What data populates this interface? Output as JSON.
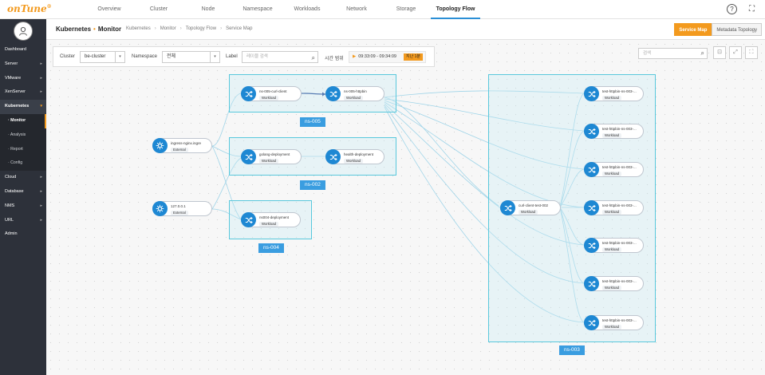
{
  "brand": {
    "name": "onTune",
    "mark": "®"
  },
  "nav": {
    "items": [
      "Overview",
      "Cluster",
      "Node",
      "Namespace",
      "Workloads",
      "Network",
      "Storage",
      "Topology Flow"
    ],
    "active": "Topology Flow"
  },
  "top_icons": [
    "help-icon",
    "fullscreen-icon"
  ],
  "sidebar": {
    "items": [
      {
        "label": "Dashboard"
      },
      {
        "label": "Server",
        "caret": "▸"
      },
      {
        "label": "VMware",
        "caret": "▸"
      },
      {
        "label": "XenServer",
        "caret": "▸"
      },
      {
        "label": "Kubernetes",
        "caret": "▾"
      }
    ],
    "sub_items": [
      "Monitor",
      "Analysis",
      "Report",
      "Config"
    ],
    "active_sub": "Monitor",
    "more_items": [
      {
        "label": "Cloud",
        "caret": "▸"
      },
      {
        "label": "Database",
        "caret": "▸"
      },
      {
        "label": "NMS",
        "caret": "▸"
      },
      {
        "label": "URL",
        "caret": "▸"
      },
      {
        "label": "Admin"
      }
    ]
  },
  "header": {
    "title_a": "Kubernetes",
    "title_b": "Monitor",
    "breadcrumb": [
      "Kubernetes",
      "Monitor",
      "Topology Flow",
      "Service Map"
    ],
    "view_buttons": [
      "Service Map",
      "Metadata Topology"
    ]
  },
  "filters": {
    "cluster_label": "Cluster",
    "cluster_value": "be-cluster",
    "namespace_label": "Namespace",
    "namespace_value": "전체",
    "label_label": "Label",
    "label_placeholder": "레이블 검색",
    "time_label": "시간 범위",
    "time_value": "09:33:09 - 09:34:09",
    "time_badge": "지난 1분"
  },
  "canvas_search": {
    "placeholder": "검색"
  },
  "groups": [
    {
      "label": "ns-005"
    },
    {
      "label": "ns-002"
    },
    {
      "label": "ns-004"
    },
    {
      "label": "ns-003"
    }
  ],
  "nodes": {
    "ingress": {
      "name": "ingress-nginx.ingre",
      "type": "External"
    },
    "local": {
      "name": "127.0.0.1",
      "type": "External"
    },
    "curl005": {
      "name": "ns-005-curl-client",
      "type": "Workload"
    },
    "httpbin005": {
      "name": "ns-005-httpbin",
      "type": "Workload"
    },
    "golang": {
      "name": "golang-deployment",
      "type": "Workload"
    },
    "health": {
      "name": "health-deployment",
      "type": "Workload"
    },
    "ns004": {
      "name": "ns004-deployment",
      "type": "Workload"
    },
    "curl002": {
      "name": "curl-client-test-002",
      "type": "Workload"
    },
    "t1": {
      "name": "test-httpbin-ns-003-...",
      "type": "Workload"
    },
    "t2": {
      "name": "test-httpbin-ns-003-...",
      "type": "Workload"
    },
    "t3": {
      "name": "test-httpbin-ns-003-...",
      "type": "Workload"
    },
    "t4": {
      "name": "test-httpbin-ns-003-...",
      "type": "Workload"
    },
    "t5": {
      "name": "test-httpbin-ns-003-...",
      "type": "Workload"
    },
    "t6": {
      "name": "test-httpbin-ns-003-...",
      "type": "Workload"
    },
    "t7": {
      "name": "test-httpbin-ns-003-...",
      "type": "Workload"
    }
  },
  "colors": {
    "accent": "#f39a1e",
    "node_blue": "#1e88d3",
    "group_border": "#59c8dc",
    "label_blue": "#3a9de0"
  }
}
